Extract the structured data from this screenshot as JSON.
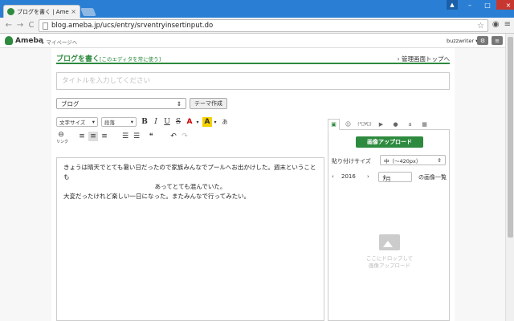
{
  "browser": {
    "tab_title": "ブログを書く | Ameba (アメーバ)",
    "tab_close": "×",
    "url": "blog.ameba.jp/ucs/entry/srventryinsertinput.do",
    "back": "←",
    "forward": "→",
    "reload": "C",
    "star": "☆",
    "camera": "◉",
    "menu": "≡",
    "user": "▲",
    "minimize": "–",
    "maximize": "□",
    "close": "×"
  },
  "site": {
    "logo": "Ameba",
    "mypage": "▸ マイページへ",
    "username": "buzzwriter ▾",
    "gear": "⚙",
    "menu": "≡"
  },
  "header": {
    "heading": "ブログを書く",
    "always_use": "[このエディタを常に使う]",
    "admin_link": "› 管理画面トップへ"
  },
  "form": {
    "title_placeholder": "タイトルを入力してください",
    "theme_value": "ブログ",
    "theme_create": "テーマ作成"
  },
  "toolbar": {
    "font_size": "文字サイズ",
    "paragraph": "段落",
    "bold": "B",
    "italic": "I",
    "underline": "U",
    "strike": "S",
    "font_color": "A",
    "bg_color": "A",
    "ruby": "あ",
    "link": "⊖",
    "link_label": "リンク",
    "align_left": "≡",
    "align_center": "≡",
    "align_right": "≡",
    "list_bullet": "☰",
    "list_number": "☰",
    "quote": "❝",
    "undo": "↶",
    "redo": "↷",
    "arrow": "▾"
  },
  "editor": {
    "line1": "きょうは晴天でとても暑い日だったので家族みんなでプールへお出かけした。週末ということも",
    "line2": "あってとても混んでいた。",
    "line3": "大変だったけれど楽しい一日になった。またみんなで行ってみたい。"
  },
  "side": {
    "tabs": [
      "▣",
      "☺",
      "(*ﾟ∀ﾟ)",
      "▶",
      "●",
      "a",
      "▦"
    ],
    "upload_button": "画像アップロード",
    "paste_size_label": "貼り付けサイズ",
    "paste_size_value": "中（〜420px）",
    "prev": "‹",
    "year": "2016",
    "next": "›",
    "month": "7月",
    "image_list": "の画像一覧",
    "drop_line1": "ここにドロップして",
    "drop_line2": "画像アップロード"
  }
}
